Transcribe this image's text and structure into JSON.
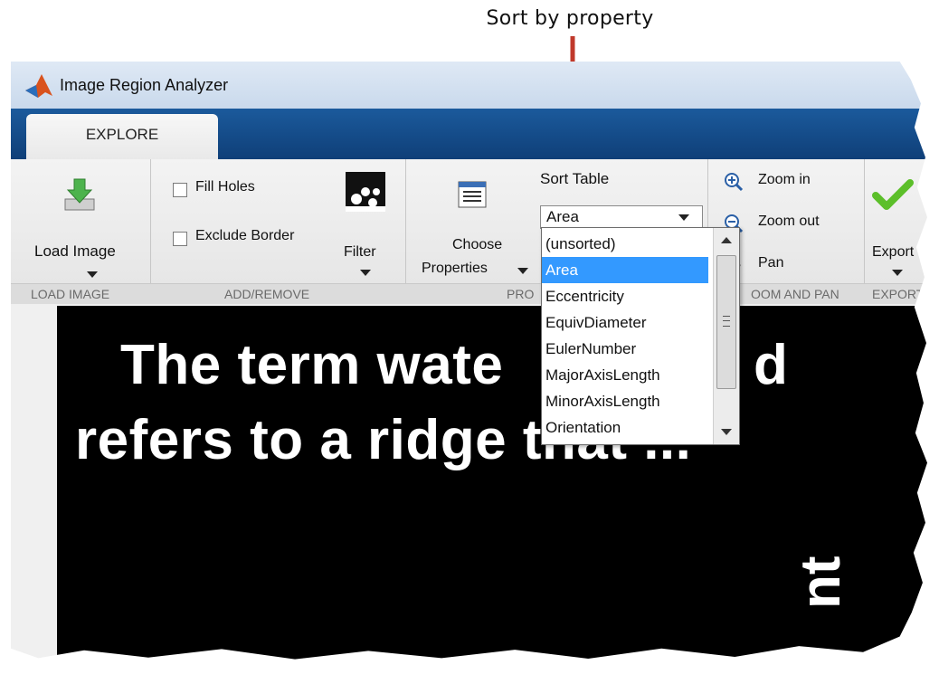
{
  "callout": {
    "text": "Sort by property"
  },
  "window": {
    "title": "Image Region Analyzer"
  },
  "tabs": [
    {
      "label": "EXPLORE"
    }
  ],
  "ribbon": {
    "load_image": {
      "label": "Load Image",
      "section": "LOAD IMAGE"
    },
    "add_remove": {
      "fill_holes": "Fill Holes",
      "exclude_border": "Exclude Border",
      "filter": "Filter",
      "section": "ADD/REMOVE"
    },
    "properties": {
      "choose_line1": "Choose",
      "choose_line2": "Properties",
      "sort_table_label": "Sort Table",
      "sort_selected": "Area",
      "section": "PRO"
    },
    "zoom": {
      "zoom_in": "Zoom in",
      "zoom_out": "Zoom out",
      "pan": "Pan",
      "section": "OOM AND PAN"
    },
    "export": {
      "label": "Export",
      "section": "EXPORT"
    }
  },
  "sort_dropdown": {
    "options": [
      "(unsorted)",
      "Area",
      "Eccentricity",
      "EquivDiameter",
      "EulerNumber",
      "MajorAxisLength",
      "MinorAxisLength",
      "Orientation"
    ],
    "selected": "Area"
  },
  "image": {
    "line1": "The term wate",
    "line1_tail": "d",
    "line2": "refers to a ridge that ...",
    "rotated": "nt"
  },
  "colors": {
    "selection": "#3399ff",
    "tabstrip": "#1b5a9c",
    "arrow": "#c0392b",
    "check_green": "#5cbf2a"
  }
}
